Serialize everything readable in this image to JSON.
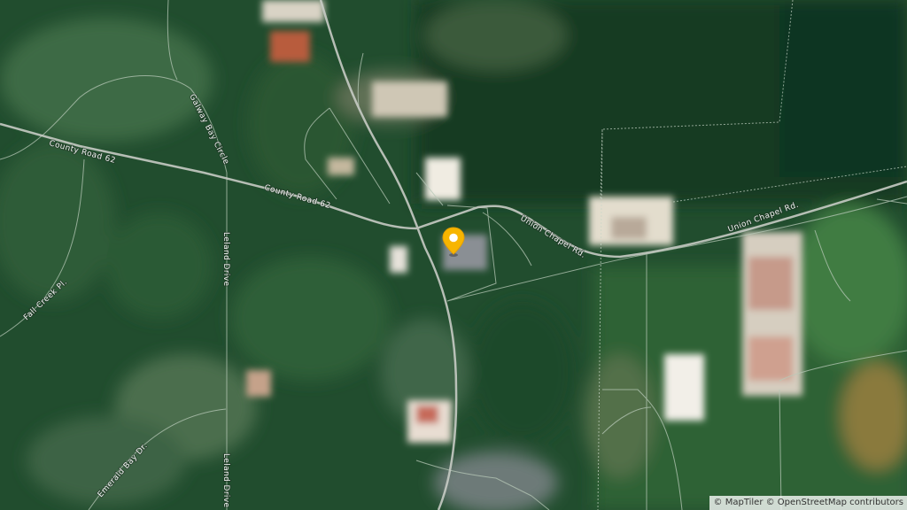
{
  "map": {
    "style": "satellite",
    "roads": {
      "county_road_62_west": "County Road 62",
      "county_road_62_east": "County Road 62",
      "union_chapel_west": "Union Chapel Rd.",
      "union_chapel_east": "Union Chapel Rd.",
      "galway_bay": "Galway Bay Circle",
      "leland_north": "Leland Drive",
      "leland_south": "Leland Drive",
      "fall_creek": "Fall Creek Pl.",
      "emerald_bay": "Emerald Bay Dr."
    },
    "marker": {
      "icon": "location-pin-icon",
      "color": "#f7b500"
    }
  },
  "attribution": {
    "maptiler": "© MapTiler",
    "osm": "© OpenStreetMap contributors"
  }
}
